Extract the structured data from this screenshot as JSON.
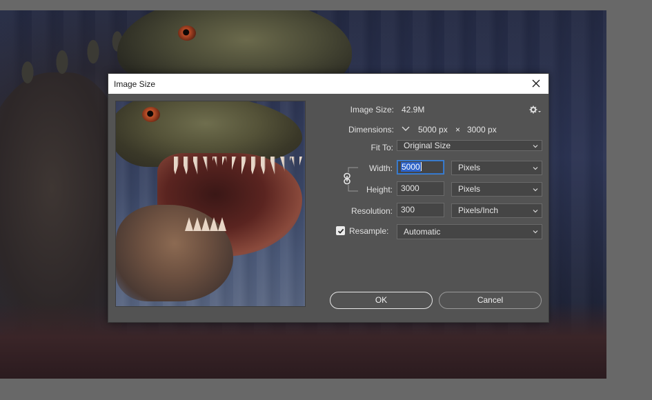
{
  "dialog": {
    "title": "Image Size",
    "image_size_label": "Image Size:",
    "image_size_value": "42.9M",
    "dimensions_label": "Dimensions:",
    "dimensions_width": "5000 px",
    "dimensions_sep": "×",
    "dimensions_height": "3000 px",
    "fit_to_label": "Fit To:",
    "fit_to_value": "Original Size",
    "width_label": "Width:",
    "width_value": "5000",
    "width_unit": "Pixels",
    "height_label": "Height:",
    "height_value": "3000",
    "height_unit": "Pixels",
    "resolution_label": "Resolution:",
    "resolution_value": "300",
    "resolution_unit": "Pixels/Inch",
    "resample_label": "Resample:",
    "resample_checked": true,
    "resample_value": "Automatic",
    "ok_label": "OK",
    "cancel_label": "Cancel"
  },
  "icons": {
    "close": "close-icon",
    "settings": "gear-icon",
    "dimensions_toggle": "chevron-down-icon",
    "constrain": "link-icon",
    "dropdown": "chevron-down-icon",
    "checkmark": "checkmark-icon"
  },
  "colors": {
    "dialog_bg": "#535353",
    "titlebar_bg": "#ffffff",
    "field_bg": "#454545",
    "focus_border": "#3f84d8",
    "selection": "#2d63c9",
    "app_bg": "#686868"
  }
}
